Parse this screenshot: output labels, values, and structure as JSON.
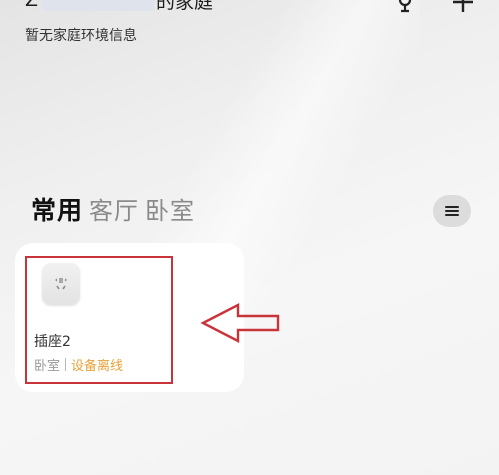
{
  "header": {
    "title_prefix": "Z",
    "title_suffix": "的家庭",
    "subtitle": "暂无家庭环境信息",
    "icons": [
      "voice-assistant-icon",
      "add-icon"
    ]
  },
  "room_tabs": [
    {
      "label": "常用",
      "active": true
    },
    {
      "label": "客厅",
      "active": false
    },
    {
      "label": "卧室",
      "active": false
    }
  ],
  "menu_button": {
    "icon": "hamburger-menu-icon"
  },
  "device": {
    "name": "插座2",
    "room": "卧室",
    "status": "设备离线",
    "icon": "smart-plug-icon"
  },
  "colors": {
    "status_offline": "#e8a23a",
    "annotation": "#c9343b",
    "card_bg": "#ffffff"
  }
}
